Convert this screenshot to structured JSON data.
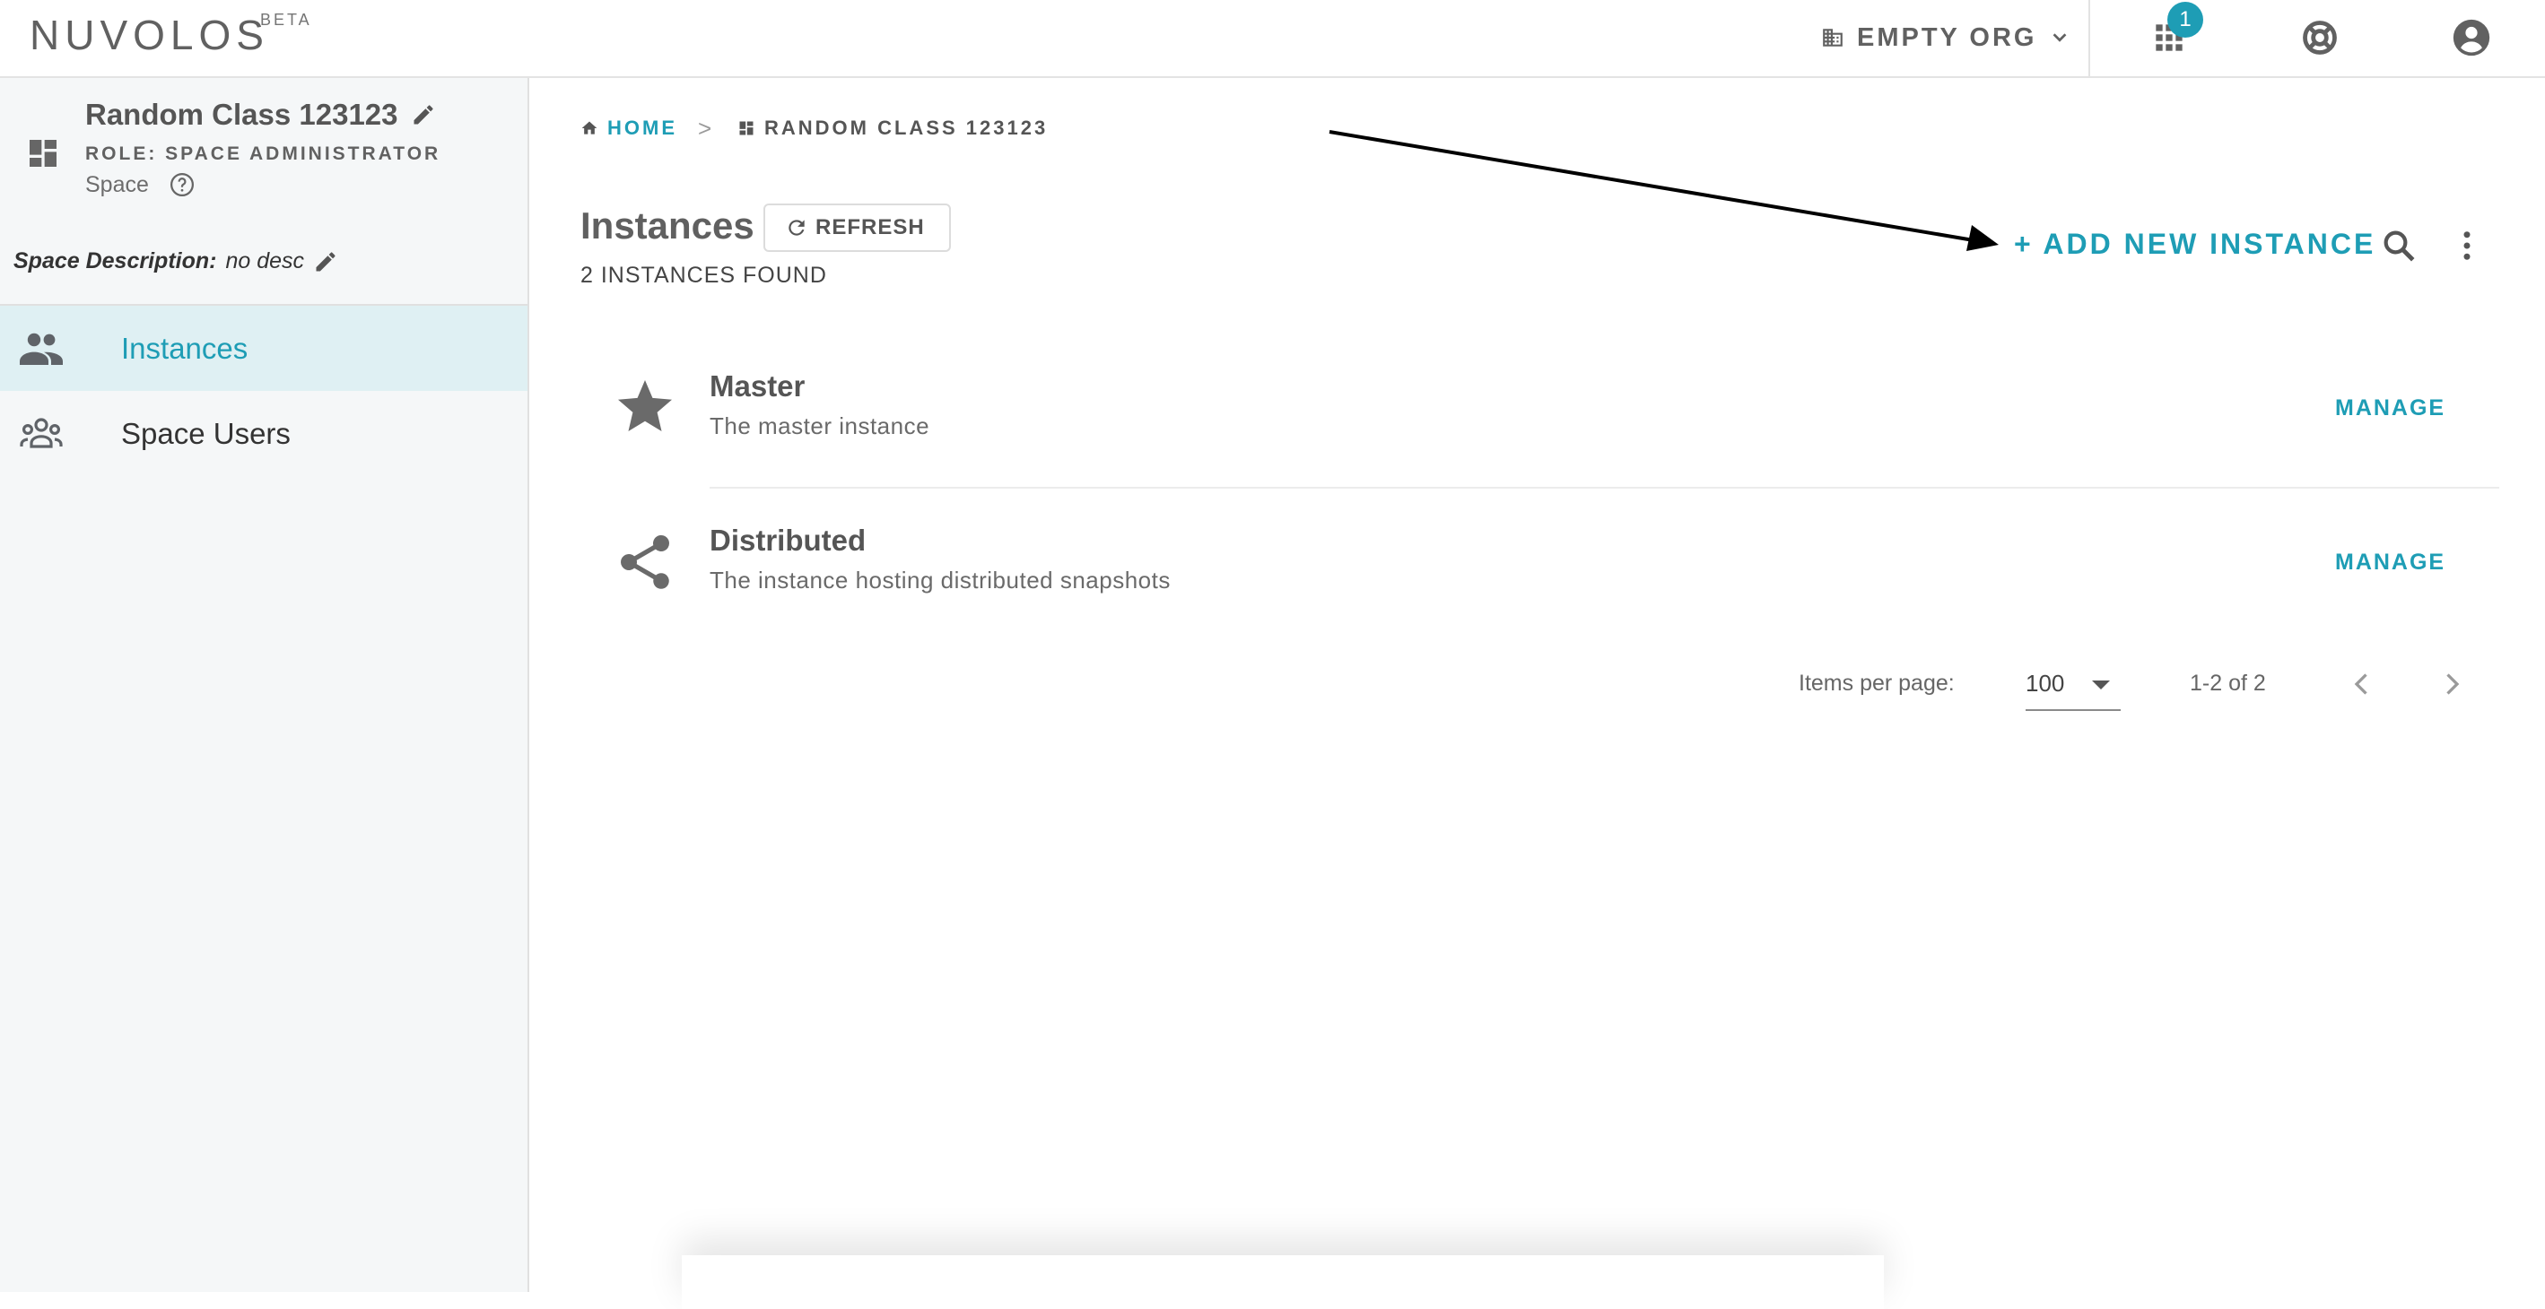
{
  "brand": {
    "name": "NUVOLOS",
    "tag": "BETA"
  },
  "topbar": {
    "org_label": "EMPTY ORG",
    "apps_badge": "1"
  },
  "sidebar": {
    "space_name": "Random Class 123123",
    "role": "ROLE: SPACE ADMINISTRATOR",
    "type": "Space",
    "description_label": "Space Description:",
    "description_value": "no desc",
    "items": [
      {
        "label": "Instances",
        "active": true
      },
      {
        "label": "Space Users",
        "active": false
      }
    ]
  },
  "breadcrumb": {
    "home": "HOME",
    "separator": ">",
    "current": "RANDOM CLASS 123123"
  },
  "main": {
    "title": "Instances",
    "refresh_label": "REFRESH",
    "count_text": "2 INSTANCES FOUND",
    "add_label": "+ ADD NEW INSTANCE"
  },
  "instances": [
    {
      "name": "Master",
      "description": "The master instance",
      "action": "MANAGE",
      "icon": "star-icon"
    },
    {
      "name": "Distributed",
      "description": "The instance hosting distributed snapshots",
      "action": "MANAGE",
      "icon": "share-icon"
    }
  ],
  "pagination": {
    "label": "Items per page:",
    "per_page": "100",
    "range": "1-2 of 2"
  },
  "colors": {
    "accent": "#1e9db5",
    "active_bg": "#dff0f3",
    "sidebar_bg": "#f5f7f8",
    "text": "#555555"
  }
}
